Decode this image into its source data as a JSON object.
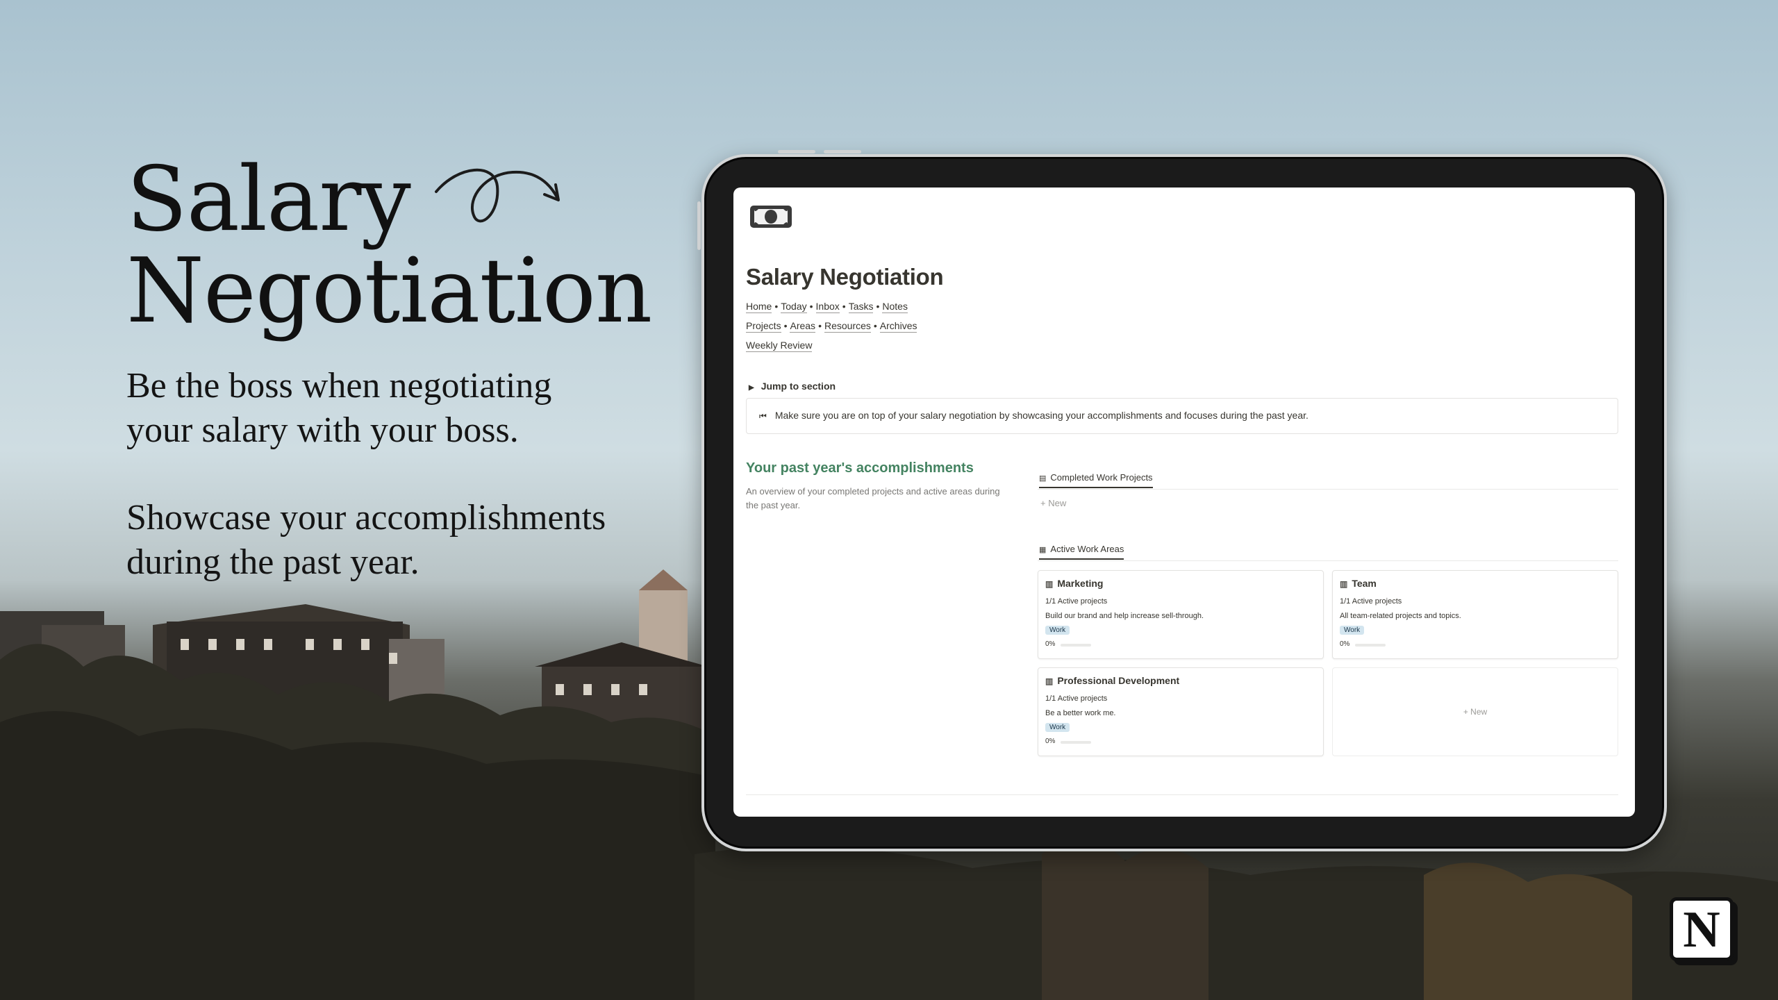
{
  "hero": {
    "title_line1": "Salary",
    "title_line2": "Negotiation",
    "sub1_line1": "Be the boss when negotiating",
    "sub1_line2": "your salary with your boss.",
    "sub2_line1": "Showcase your accomplishments",
    "sub2_line2": "during the past year."
  },
  "page": {
    "icon": "banknote-icon",
    "title": "Salary Negotiation",
    "nav_rows": [
      [
        "Home",
        "Today",
        "Inbox",
        "Tasks",
        "Notes"
      ],
      [
        "Projects",
        "Areas",
        "Resources",
        "Archives"
      ],
      [
        "Weekly Review"
      ]
    ],
    "nav_separator": "•",
    "toggle_label": "Jump to section",
    "callout_icon": "rewind-icon",
    "callout_text": "Make sure you are on top of your salary negotiation by showcasing your accomplishments and focuses during the past year.",
    "section_title": "Your past year's accomplishments",
    "section_desc": "An overview of your completed projects and active areas during the past year.",
    "completed_tab": "Completed Work Projects",
    "new_label": "+ New",
    "areas_tab": "Active Work Areas",
    "cards": [
      {
        "title": "Marketing",
        "projects": "1/1 Active projects",
        "desc": "Build our brand and help increase sell-through.",
        "tag": "Work",
        "progress": "0%"
      },
      {
        "title": "Team",
        "projects": "1/1 Active projects",
        "desc": "All team-related projects and topics.",
        "tag": "Work",
        "progress": "0%"
      },
      {
        "title": "Professional Development",
        "projects": "1/1 Active projects",
        "desc": "Be a better work me.",
        "tag": "Work",
        "progress": "0%"
      }
    ],
    "empty_card_label": "+ New"
  },
  "brand": {
    "logo_letter": "N",
    "logo_icon": "notion-logo-icon"
  },
  "colors": {
    "accent_green": "#448361",
    "tag_blue": "#d3e5ef",
    "text": "#37352f"
  }
}
